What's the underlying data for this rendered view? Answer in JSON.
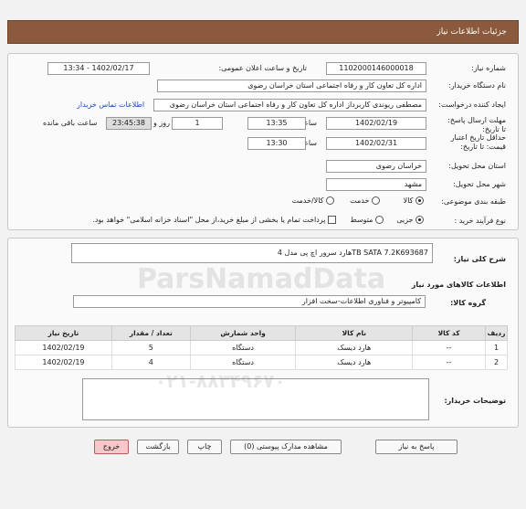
{
  "header": {
    "title": "جزئیات اطلاعات نیاز"
  },
  "form": {
    "need_number_label": "شماره نیاز:",
    "need_number": "1102000146000018",
    "announce_label": "تاریخ و ساعت اعلان عمومی:",
    "announce_value": "1402/02/17 - 13:34",
    "buyer_org_label": "نام دستگاه خریدار:",
    "buyer_org": "اداره کل تعاون  کار و رفاه اجتماعی استان خراسان رضوی",
    "creator_label": "ایجاد کننده درخواست:",
    "creator": "مصطفی  ریوندی کاربرداز اداره کل تعاون  کار و رفاه اجتماعی استان خراسان رضوی",
    "contact_link": "اطلاعات تماس خریدار",
    "deadline_label": "مهلت ارسال پاسخ: تا تاریخ:",
    "deadline_date": "1402/02/19",
    "time_label": "ساعت",
    "deadline_time": "13:35",
    "days_value": "1",
    "days_label": "روز و",
    "remaining_time": "23:45:38",
    "remaining_label": "ساعت باقی مانده",
    "validity_label": "حداقل تاریخ اعتبار قیمت: تا تاریخ:",
    "validity_date": "1402/02/31",
    "validity_time": "13:30",
    "province_label": "استان محل تحویل:",
    "province": "خراسان رضوی",
    "city_label": "شهر محل تحویل:",
    "city": "مشهد",
    "category_label": "طبقه بندی موضوعی:",
    "category_options": [
      "کالا",
      "خدمت",
      "کالا/خدمت"
    ],
    "process_label": "نوع فرآیند خرید :",
    "process_options": [
      "جزیی",
      "متوسط"
    ],
    "payment_note": "پرداخت تمام یا بخشی از مبلغ خرید،از محل \"اسناد خزانه اسلامی\" خواهد بود."
  },
  "details": {
    "summary_label": "شرح کلی نیاز:",
    "summary": "هارد سرور اچ پی مدل 4TB SATA 7.2K693687",
    "goods_info_label": "اطلاعات کالاهای مورد نیاز",
    "group_label": "گروه کالا:",
    "group": "کامپیوتر و فناوری اطلاعات-سخت افزار",
    "table": {
      "headers": [
        "ردیف",
        "کد کالا",
        "نام کالا",
        "واحد شمارش",
        "تعداد / مقدار",
        "تاریخ نیاز"
      ],
      "rows": [
        [
          "1",
          "--",
          "هارد دیسک",
          "دستگاه",
          "5",
          "1402/02/19"
        ],
        [
          "2",
          "--",
          "هارد دیسک",
          "دستگاه",
          "4",
          "1402/02/19"
        ]
      ]
    },
    "buyer_notes_label": "توضیحات خریدار:"
  },
  "buttons": {
    "reply": "پاسخ به نیاز",
    "view_docs": "مشاهده مدارک پیوستی (0)",
    "print": "چاپ",
    "back": "بازگشت",
    "exit": "خروج"
  },
  "watermark": {
    "line1": "ParsNamadData",
    "line2": "۰۲۱-۸۸۳۴۹۶۷۰"
  },
  "colors": {
    "header_bg": "#8b5a3c",
    "link": "#1a4fb5",
    "exit_bg": "#f4c9c9"
  }
}
